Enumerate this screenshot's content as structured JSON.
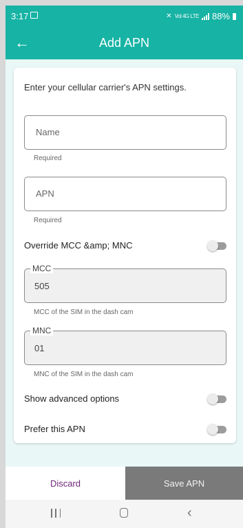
{
  "status_bar": {
    "time": "3:17",
    "network_label": "Vol 4G LTE",
    "battery": "88%"
  },
  "app_bar": {
    "title": "Add APN",
    "back_icon": "arrow-left-icon"
  },
  "form": {
    "intro": "Enter your cellular carrier's APN settings.",
    "name": {
      "placeholder": "Name",
      "value": "",
      "helper": "Required"
    },
    "apn": {
      "placeholder": "APN",
      "value": "",
      "helper": "Required"
    },
    "override_label": "Override MCC &amp; MNC",
    "override_on": false,
    "mcc": {
      "label": "MCC",
      "value": "505",
      "helper": "MCC of the SIM in the dash cam"
    },
    "mnc": {
      "label": "MNC",
      "value": "01",
      "helper": "MNC of the SIM in the dash cam"
    },
    "advanced_label": "Show advanced options",
    "advanced_on": false,
    "prefer_label": "Prefer this APN",
    "prefer_on": false
  },
  "actions": {
    "discard": "Discard",
    "save": "Save APN"
  },
  "colors": {
    "accent": "#17b3a4",
    "discard_text": "#6e2778",
    "save_bg": "#7a7a7a"
  }
}
